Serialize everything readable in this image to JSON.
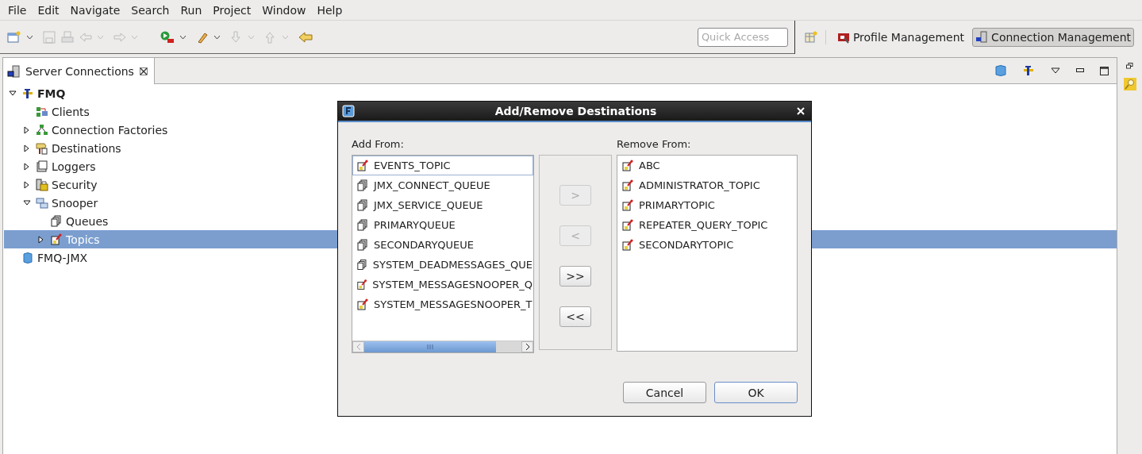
{
  "menu": [
    "File",
    "Edit",
    "Navigate",
    "Search",
    "Run",
    "Project",
    "Window",
    "Help"
  ],
  "quick_access": {
    "placeholder": "Quick Access"
  },
  "perspectives": [
    {
      "label": "Profile Management",
      "kind": "profile",
      "selected": false
    },
    {
      "label": "Connection Management",
      "kind": "connection",
      "selected": true
    }
  ],
  "view_tab": {
    "title": "Server Connections"
  },
  "tree": [
    {
      "label": "FMQ",
      "kind": "server",
      "bold": true,
      "expanded": true,
      "selected": false,
      "children": [
        {
          "label": "Clients",
          "kind": "clients",
          "bold": false,
          "selected": false
        },
        {
          "label": "Connection Factories",
          "kind": "factories",
          "bold": false,
          "expanded": false,
          "selected": false
        },
        {
          "label": "Destinations",
          "kind": "destinations",
          "bold": false,
          "expanded": false,
          "selected": false
        },
        {
          "label": "Loggers",
          "kind": "loggers",
          "bold": false,
          "expanded": false,
          "selected": false
        },
        {
          "label": "Security",
          "kind": "security",
          "bold": false,
          "expanded": false,
          "selected": false
        },
        {
          "label": "Snooper",
          "kind": "snooper",
          "bold": false,
          "expanded": true,
          "selected": false,
          "children": [
            {
              "label": "Queues",
              "kind": "queue",
              "bold": false,
              "selected": false
            },
            {
              "label": "Topics",
              "kind": "topic",
              "bold": false,
              "expanded": false,
              "selected": true
            }
          ]
        }
      ]
    },
    {
      "label": "FMQ-JMX",
      "kind": "jmx",
      "bold": false,
      "selected": false
    }
  ],
  "dialog": {
    "title": "Add/Remove Destinations",
    "add_label": "Add From:",
    "add_items": [
      {
        "label": "EVENTS_TOPIC",
        "kind": "topic",
        "focused": true
      },
      {
        "label": "JMX_CONNECT_QUEUE",
        "kind": "queue",
        "focused": false
      },
      {
        "label": "JMX_SERVICE_QUEUE",
        "kind": "queue",
        "focused": false
      },
      {
        "label": "PRIMARYQUEUE",
        "kind": "queue",
        "focused": false
      },
      {
        "label": "SECONDARYQUEUE",
        "kind": "queue",
        "focused": false
      },
      {
        "label": "SYSTEM_DEADMESSAGES_QUE",
        "kind": "queue",
        "focused": false
      },
      {
        "label": "SYSTEM_MESSAGESNOOPER_Q",
        "kind": "topic",
        "focused": false
      },
      {
        "label": "SYSTEM_MESSAGESNOOPER_T",
        "kind": "topic",
        "focused": false
      }
    ],
    "move_buttons": [
      {
        "label": ">",
        "disabled": true
      },
      {
        "label": "<",
        "disabled": true
      },
      {
        "label": ">>",
        "disabled": false
      },
      {
        "label": "<<",
        "disabled": false
      }
    ],
    "remove_label": "Remove From:",
    "remove_items": [
      {
        "label": "ABC",
        "kind": "topic",
        "focused": false
      },
      {
        "label": "ADMINISTRATOR_TOPIC",
        "kind": "topic",
        "focused": false
      },
      {
        "label": "PRIMARYTOPIC",
        "kind": "topic",
        "focused": false
      },
      {
        "label": "REPEATER_QUERY_TOPIC",
        "kind": "topic",
        "focused": false
      },
      {
        "label": "SECONDARYTOPIC",
        "kind": "topic",
        "focused": false
      }
    ],
    "buttons": [
      {
        "label": "Cancel",
        "default": false
      },
      {
        "label": "OK",
        "default": true
      }
    ]
  }
}
